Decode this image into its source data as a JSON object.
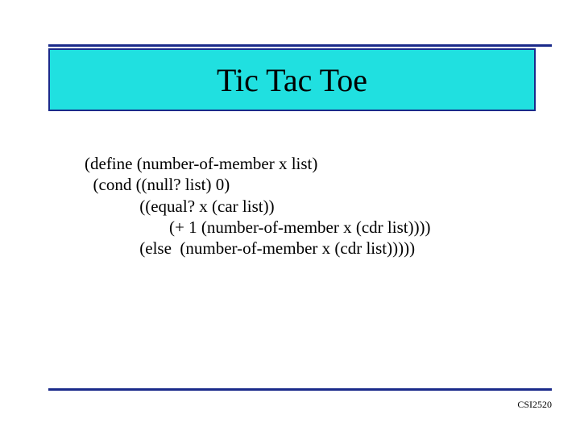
{
  "title": "Tic Tac Toe",
  "code": "(define (number-of-member x list)\n  (cond ((null? list) 0)\n             ((equal? x (car list))\n                    (+ 1 (number-of-member x (cdr list))))\n             (else  (number-of-member x (cdr list)))))",
  "footer": "CSI2520"
}
